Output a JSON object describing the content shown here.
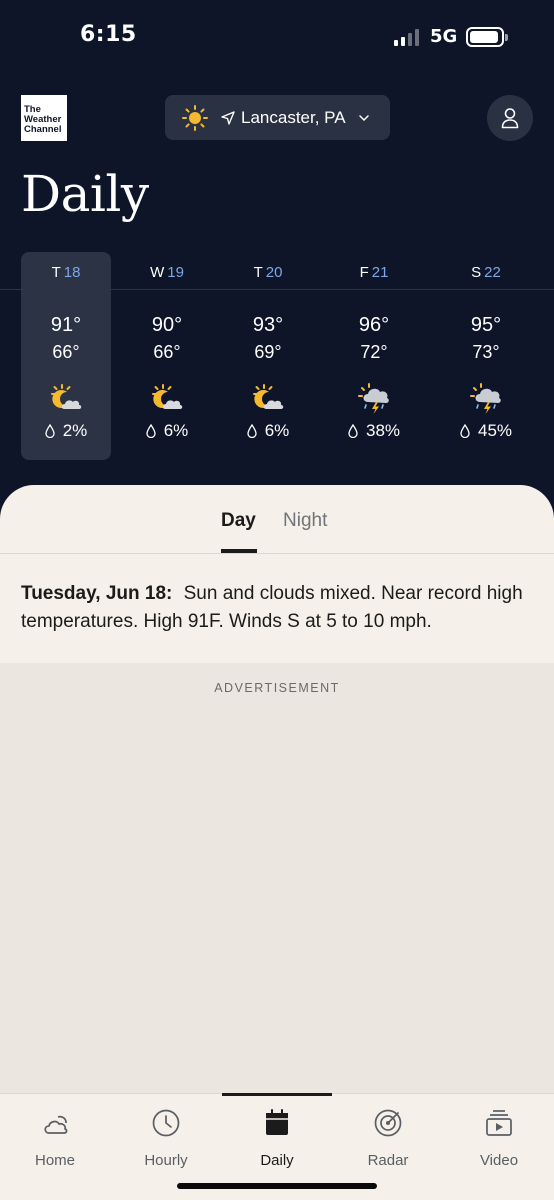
{
  "status_bar": {
    "time": "6:15",
    "network": "5G"
  },
  "header": {
    "logo_lines": [
      "The",
      "Weather",
      "Channel"
    ],
    "location": "Lancaster, PA",
    "title": "Daily"
  },
  "days": [
    {
      "dow": "T",
      "date": "18",
      "high": "91°",
      "low": "66°",
      "icon": "partly-cloudy-night-icon",
      "precip": "2%",
      "selected": true
    },
    {
      "dow": "W",
      "date": "19",
      "high": "90°",
      "low": "66°",
      "icon": "partly-cloudy-night-icon",
      "precip": "6%"
    },
    {
      "dow": "T",
      "date": "20",
      "high": "93°",
      "low": "69°",
      "icon": "partly-cloudy-night-icon",
      "precip": "6%"
    },
    {
      "dow": "F",
      "date": "21",
      "high": "96°",
      "low": "72°",
      "icon": "thunderstorm-icon",
      "precip": "38%"
    },
    {
      "dow": "S",
      "date": "22",
      "high": "95°",
      "low": "73°",
      "icon": "thunderstorm-icon",
      "precip": "45%"
    }
  ],
  "tabs": {
    "day": "Day",
    "night": "Night",
    "active": "day"
  },
  "forecast": {
    "date": "Tuesday, Jun 18:",
    "text": "Sun and clouds mixed. Near record high temperatures. High 91F. Winds S at 5 to 10 mph."
  },
  "ad": {
    "label": "ADVERTISEMENT"
  },
  "nav": [
    {
      "label": "Home",
      "icon": "cloud-moon-icon"
    },
    {
      "label": "Hourly",
      "icon": "clock-icon"
    },
    {
      "label": "Daily",
      "icon": "calendar-icon",
      "active": true
    },
    {
      "label": "Radar",
      "icon": "radar-icon"
    },
    {
      "label": "Video",
      "icon": "video-icon"
    }
  ],
  "colors": {
    "background": "#0e1528",
    "accent_date": "#7fa6e8",
    "sun": "#f5b82e",
    "sheet": "#f5f1ea"
  }
}
